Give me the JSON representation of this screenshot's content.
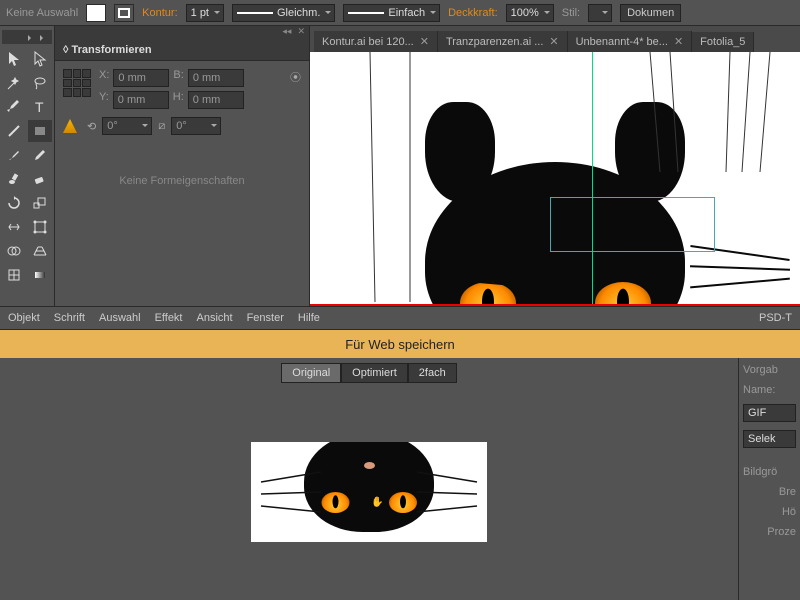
{
  "optbar": {
    "no_selection": "Keine Auswahl",
    "stroke_label": "Kontur:",
    "stroke_value": "1 pt",
    "uniform": "Gleichm.",
    "basic": "Einfach",
    "opacity_label": "Deckkraft:",
    "opacity_value": "100%",
    "style_label": "Stil:",
    "doc_setup": "Dokumen"
  },
  "panel": {
    "title": "Transformieren",
    "x_lbl": "X:",
    "x_val": "0 mm",
    "y_lbl": "Y:",
    "y_val": "0 mm",
    "b_lbl": "B:",
    "b_val": "0 mm",
    "h_lbl": "H:",
    "h_val": "0 mm",
    "angle1": "0°",
    "angle2": "0°",
    "no_shape": "Keine Formeigenschaften"
  },
  "tabs": [
    "Kontur.ai bei 120...",
    "Tranzparenzen.ai ...",
    "Unbenannt-4* be...",
    "Fotolia_5"
  ],
  "menu": {
    "items": [
      "Objekt",
      "Schrift",
      "Auswahl",
      "Effekt",
      "Ansicht",
      "Fenster",
      "Hilfe"
    ],
    "right": "PSD-T"
  },
  "web": {
    "title": "Für Web speichern",
    "views": {
      "original": "Original",
      "optimized": "Optimiert",
      "two_up": "2fach"
    },
    "side": {
      "preset_lbl": "Vorgab",
      "name_lbl": "Name:",
      "format": "GIF",
      "select": "Selek",
      "size_lbl": "Bildgrö",
      "b_lbl": "Bre",
      "h_lbl": "Hö",
      "pct_lbl": "Proze"
    }
  }
}
